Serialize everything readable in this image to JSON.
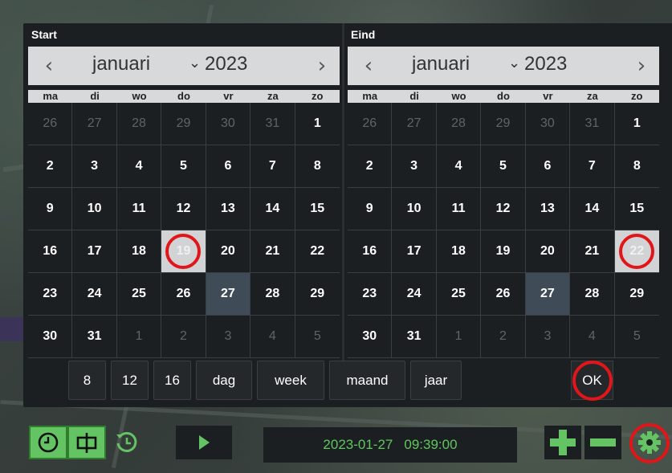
{
  "start": {
    "title": "Start",
    "month": "januari",
    "year": "2023",
    "prev_icon": "chevron-left-icon",
    "next_icon": "chevron-right-icon"
  },
  "end": {
    "title": "Eind",
    "month": "januari",
    "year": "2023"
  },
  "weekdays": [
    "ma",
    "di",
    "wo",
    "do",
    "vr",
    "za",
    "zo"
  ],
  "days": [
    [
      "26",
      "27",
      "28",
      "29",
      "30",
      "31",
      "1"
    ],
    [
      "2",
      "3",
      "4",
      "5",
      "6",
      "7",
      "8"
    ],
    [
      "9",
      "10",
      "11",
      "12",
      "13",
      "14",
      "15"
    ],
    [
      "16",
      "17",
      "18",
      "19",
      "20",
      "21",
      "22"
    ],
    [
      "23",
      "24",
      "25",
      "26",
      "27",
      "28",
      "29"
    ],
    [
      "30",
      "31",
      "1",
      "2",
      "3",
      "4",
      "5"
    ]
  ],
  "quick_buttons": [
    "8",
    "12",
    "16",
    "dag",
    "week",
    "maand",
    "jaar"
  ],
  "ok_label": "OK",
  "toolbar": {
    "date": "2023-01-27",
    "time": "09:39:00"
  },
  "colors": {
    "accent_green": "#64c464",
    "highlight_red": "#e0161a",
    "panel": "#1c1f22"
  }
}
